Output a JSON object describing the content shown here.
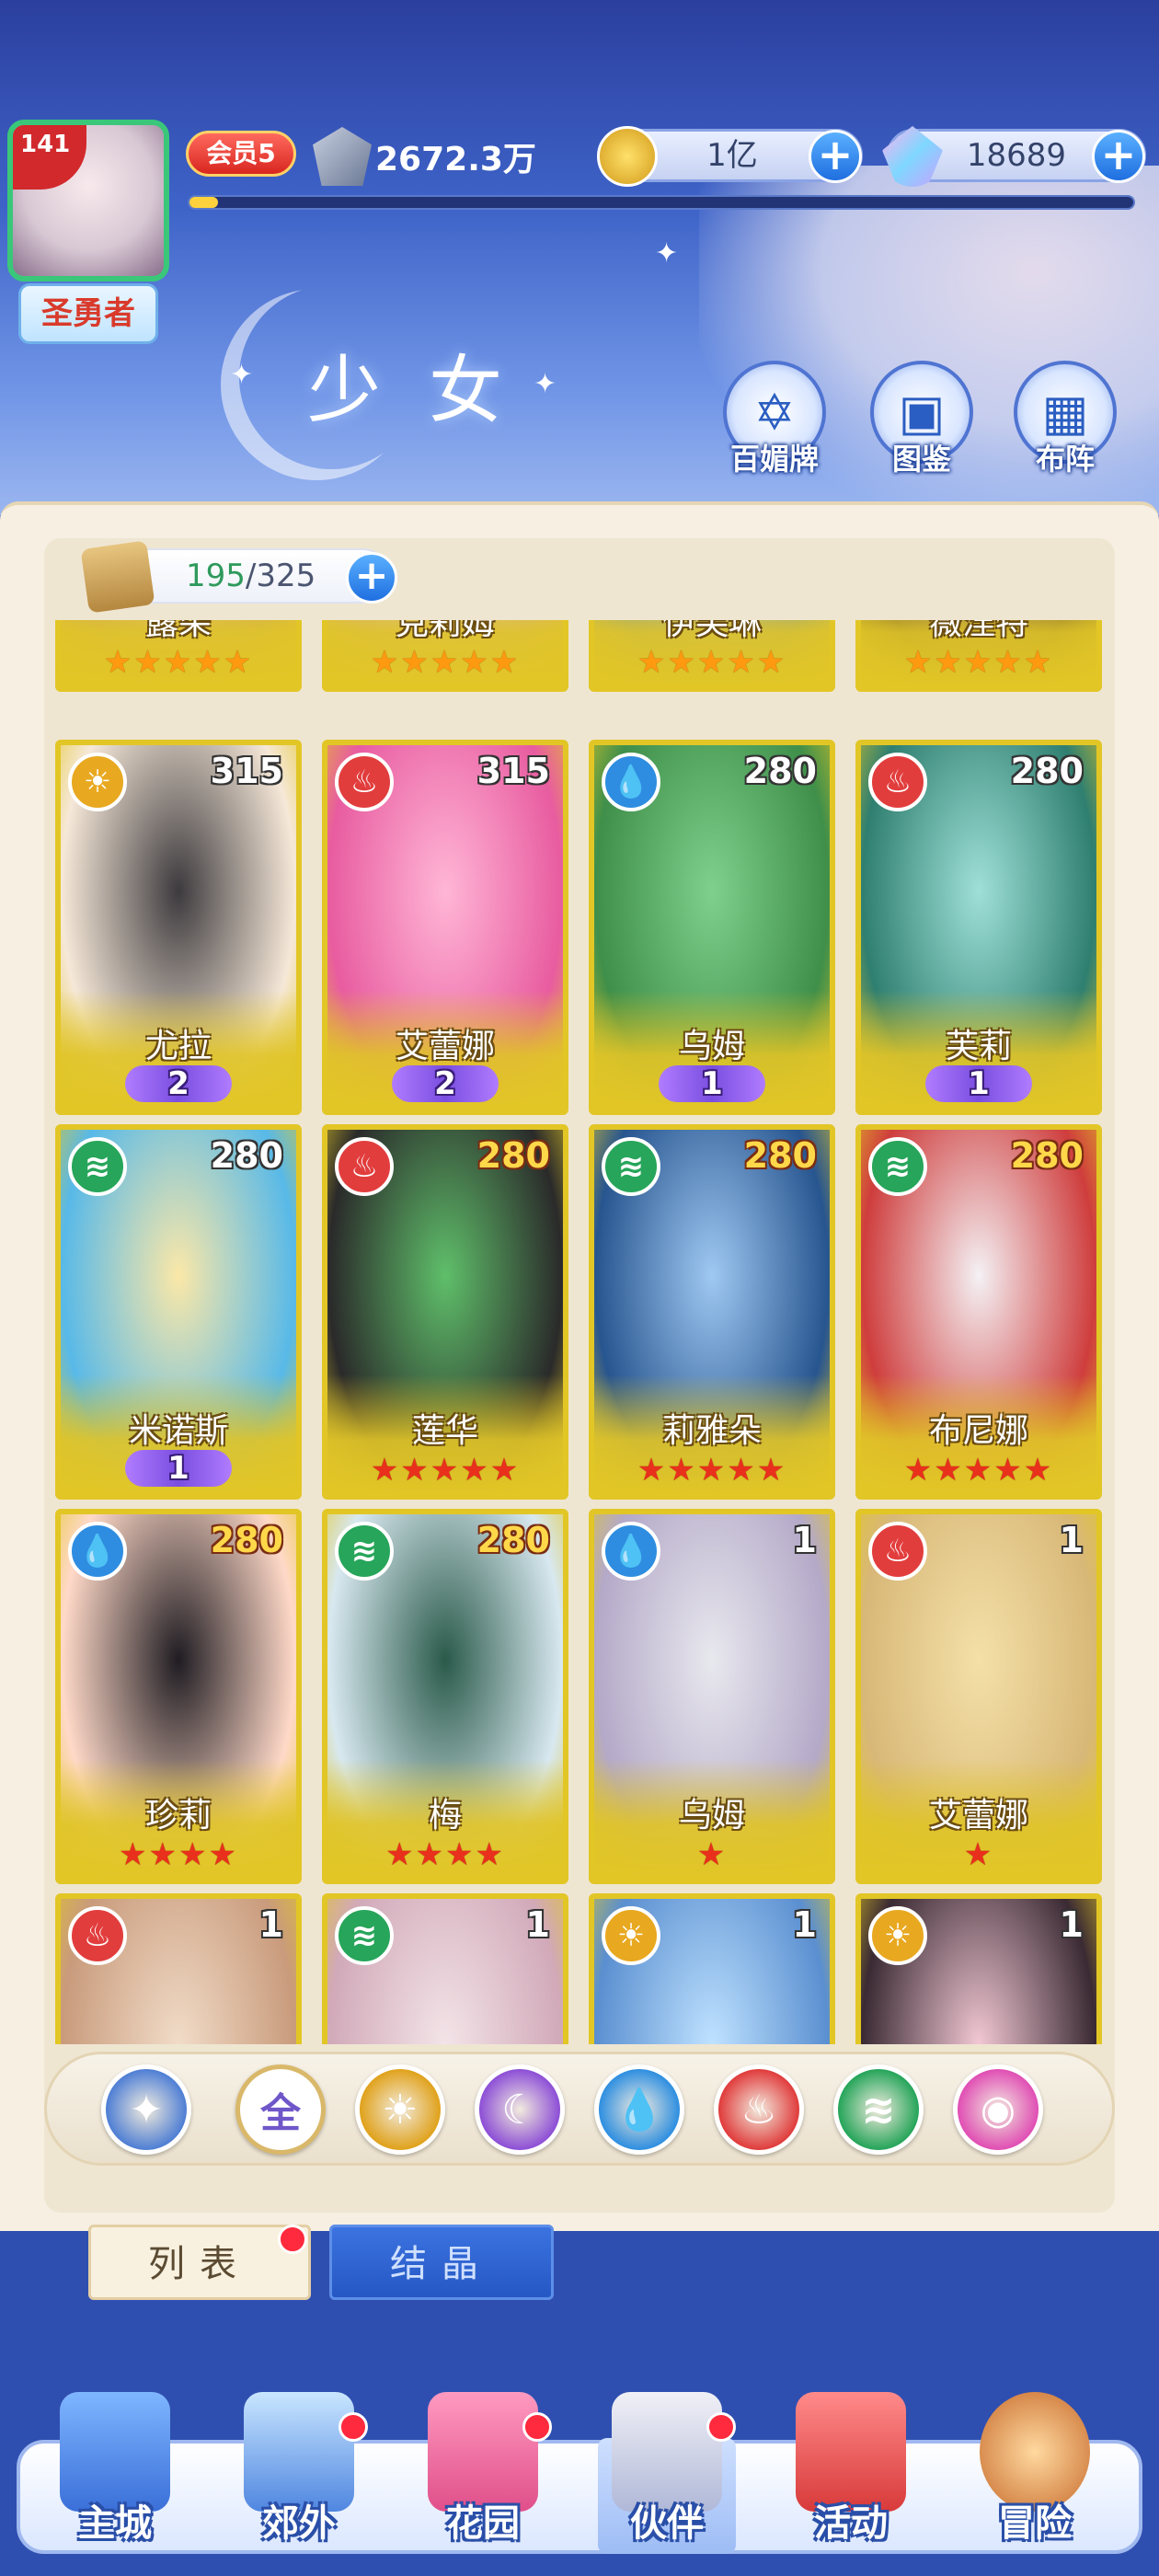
{
  "header": {
    "player_level": "141",
    "player_title": "圣勇者",
    "vip_label": "会员5",
    "power": "2672.3万",
    "exp_fraction": 0.03,
    "gold": "1亿",
    "gems": "18689",
    "page_title": "少女"
  },
  "top_buttons": [
    {
      "label": "百媚牌",
      "icon": "card-icon"
    },
    {
      "label": "图鉴",
      "icon": "book-icon"
    },
    {
      "label": "布阵",
      "icon": "formation-icon"
    }
  ],
  "capacity": {
    "current": "195",
    "max": "/325"
  },
  "rows": [
    [
      {
        "name": "露朵",
        "level": "",
        "element": "",
        "stars": "★★★★★",
        "star_color": "orange"
      },
      {
        "name": "克莉姆",
        "level": "",
        "element": "",
        "stars": "★★★★★",
        "star_color": "orange"
      },
      {
        "name": "伊芙琳",
        "level": "",
        "element": "",
        "stars": "★★★★★",
        "star_color": "orange"
      },
      {
        "name": "薇涅特",
        "level": "",
        "element": "",
        "stars": "★★★★★",
        "star_color": "orange"
      }
    ],
    [
      {
        "name": "尤拉",
        "level": "315",
        "element": "light",
        "wing": "2"
      },
      {
        "name": "艾蕾娜",
        "level": "315",
        "element": "fire",
        "wing": "2"
      },
      {
        "name": "乌姆",
        "level": "280",
        "element": "water",
        "wing": "1"
      },
      {
        "name": "芙莉",
        "level": "280",
        "element": "fire",
        "wing": "1"
      }
    ],
    [
      {
        "name": "米诺斯",
        "level": "280",
        "element": "wind",
        "wing": "1"
      },
      {
        "name": "莲华",
        "level": "280",
        "level_color": "gold",
        "element": "fire",
        "stars": "★★★★★",
        "star_color": "red"
      },
      {
        "name": "莉雅朵",
        "level": "280",
        "level_color": "gold",
        "element": "wind",
        "stars": "★★★★★",
        "star_color": "red"
      },
      {
        "name": "布尼娜",
        "level": "280",
        "level_color": "gold",
        "element": "wind",
        "stars": "★★★★★",
        "star_color": "red"
      }
    ],
    [
      {
        "name": "珍莉",
        "level": "280",
        "level_color": "gold",
        "element": "water",
        "stars": "★★★★",
        "star_color": "red"
      },
      {
        "name": "梅",
        "level": "280",
        "level_color": "gold",
        "element": "wind",
        "stars": "★★★★",
        "star_color": "red"
      },
      {
        "name": "乌姆",
        "level": "1",
        "element": "water",
        "stars": "★",
        "star_color": "red"
      },
      {
        "name": "艾蕾娜",
        "level": "1",
        "element": "fire",
        "stars": "★",
        "star_color": "red"
      }
    ],
    [
      {
        "name": "",
        "level": "1",
        "element": "fire"
      },
      {
        "name": "",
        "level": "1",
        "element": "wind"
      },
      {
        "name": "",
        "level": "1",
        "element": "light"
      },
      {
        "name": "",
        "level": "1",
        "element": "light"
      }
    ]
  ],
  "filters": [
    {
      "label": "",
      "icon": "sort-icon",
      "color": "#4f7fd4"
    },
    {
      "label": "全",
      "icon": "all-icon",
      "color": "#6f57c9"
    },
    {
      "label": "",
      "icon": "light-icon",
      "color": "#e0a21c"
    },
    {
      "label": "",
      "icon": "dark-moon-icon",
      "color": "#8d4fd6"
    },
    {
      "label": "",
      "icon": "water-icon",
      "color": "#2f8fe0"
    },
    {
      "label": "",
      "icon": "fire-icon",
      "color": "#e03c3c"
    },
    {
      "label": "",
      "icon": "wind-icon",
      "color": "#26a55a"
    },
    {
      "label": "",
      "icon": "arcane-icon",
      "color": "#e04fb4"
    }
  ],
  "tabs": {
    "list": "列表",
    "crystal": "结晶"
  },
  "nav": [
    {
      "label": "主城",
      "icon": "castle-icon",
      "badge": false
    },
    {
      "label": "郊外",
      "icon": "star-medal-icon",
      "badge": true
    },
    {
      "label": "花园",
      "icon": "heart-icon",
      "badge": true
    },
    {
      "label": "伙伴",
      "icon": "partner-icon",
      "badge": true
    },
    {
      "label": "活动",
      "icon": "gift-icon",
      "badge": false
    },
    {
      "label": "冒险",
      "icon": "compass-icon",
      "badge": false
    }
  ],
  "colors": {
    "light": "#e8a820",
    "fire": "#e23d3d",
    "water": "#2e8de0",
    "wind": "#27a55a"
  }
}
